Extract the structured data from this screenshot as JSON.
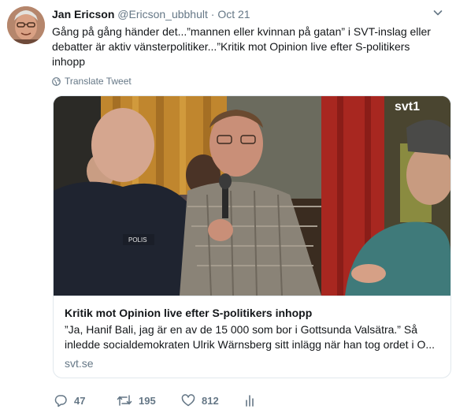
{
  "tweet": {
    "author_name": "Jan Ericson",
    "handle": "@Ericson_ubbhult",
    "separator": "·",
    "time": "Oct 21",
    "text": "Gång på gång händer det...”mannen eller kvinnan på gatan” i SVT-inslag eller debatter är aktiv vänsterpolitiker...”Kritik mot Opinion live efter S-politikers inhopp",
    "translate_label": "Translate Tweet"
  },
  "card": {
    "image_watermark": "svt1",
    "badge_text": "POLIS",
    "title": "Kritik mot Opinion live efter S-politikers inhopp",
    "description": "”Ja, Hanif Bali, jag är en av de 15 000 som bor i Gottsunda Valsätra.” Så inledde socialdemokraten Ulrik Wärnsberg sitt inlägg när han tog ordet i O...",
    "domain": "svt.se"
  },
  "actions": {
    "replies": "47",
    "retweets": "195",
    "likes": "812"
  },
  "colors": {
    "text_primary": "#14171a",
    "text_secondary": "#657786",
    "border": "#e1e8ed"
  }
}
